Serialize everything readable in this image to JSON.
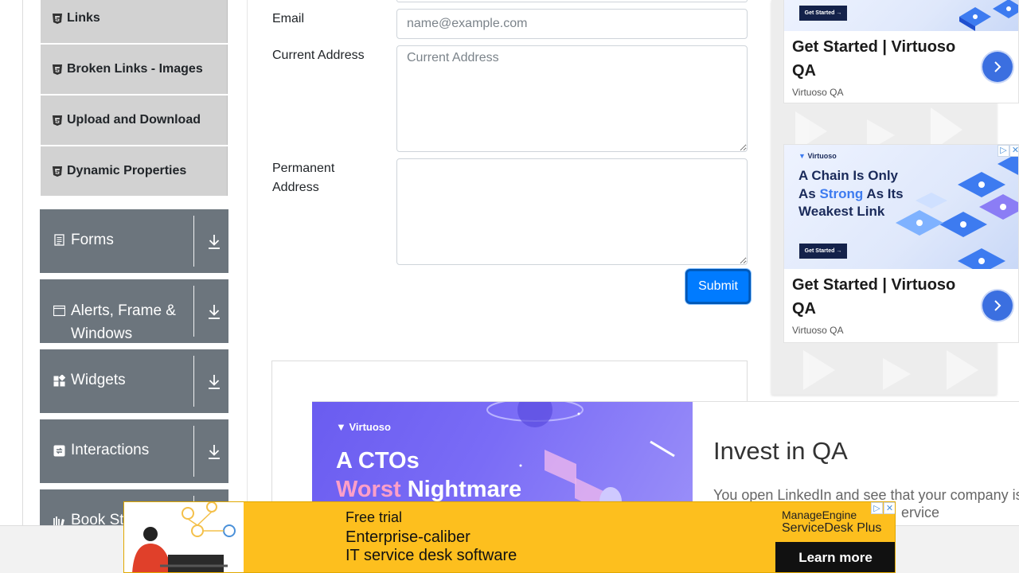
{
  "sidebar": {
    "sub_items": [
      {
        "label": "Links"
      },
      {
        "label": "Broken Links - Images"
      },
      {
        "label": "Upload and Download"
      },
      {
        "label": "Dynamic Properties"
      }
    ],
    "groups": [
      {
        "label": "Forms",
        "icon": "document-icon"
      },
      {
        "label": "Alerts, Frame & Windows",
        "icon": "window-icon"
      },
      {
        "label": "Widgets",
        "icon": "widgets-icon"
      },
      {
        "label": "Interactions",
        "icon": "interactions-icon"
      },
      {
        "label": "Book Store Application",
        "icon": "bookstore-icon"
      }
    ]
  },
  "form": {
    "email_label": "Email",
    "email_placeholder": "name@example.com",
    "current_address_label": "Current Address",
    "current_address_placeholder": "Current Address",
    "permanent_address_label_1": "Permanent",
    "permanent_address_label_2": "Address",
    "submit_label": "Submit"
  },
  "right_ads": {
    "card1": {
      "headline": "Get Started | Virtuoso QA",
      "source": "Virtuoso QA",
      "mini_button": "Get Started →"
    },
    "card2": {
      "brand": "Virtuoso",
      "line1": "A Chain Is Only",
      "line2_pre": "As ",
      "line2_accent": "Strong",
      "line2_post": " As Its",
      "line3": "Weakest Link",
      "mini_button": "Get Started →",
      "headline": "Get Started | Virtuoso QA",
      "source": "Virtuoso QA"
    }
  },
  "middle_ad": {
    "logo": "Virtuoso",
    "title_line1": "A CTOs",
    "title_line2_accent": "Worst",
    "title_line2_rest": " Nightmare",
    "heading": "Invest in QA",
    "body_line1": "You open LinkedIn and see that your company is",
    "body_line2": "ervice"
  },
  "bottom_ad": {
    "line1": "Free trial",
    "line2": "Enterprise-caliber",
    "line3": "IT service desk software",
    "brand1": "ManageEngine",
    "brand2": "ServiceDesk Plus",
    "cta": "Learn more"
  },
  "colors": {
    "sidebar_group_bg": "#6c757d",
    "sidebar_item_bg": "#d2d2d2",
    "submit_bg": "#007bff",
    "bottom_ad_bg": "#fdbf1e"
  }
}
